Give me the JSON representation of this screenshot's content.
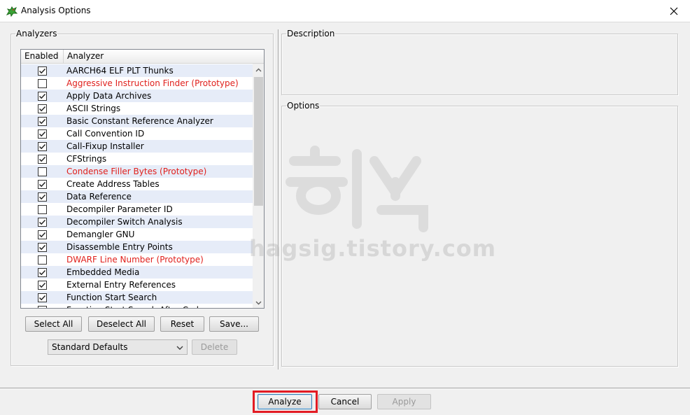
{
  "window": {
    "title": "Analysis Options",
    "icon": "ghidra-dragon-icon"
  },
  "analyzers": {
    "legend": "Analyzers",
    "columns": [
      "Enabled",
      "Analyzer"
    ],
    "items": [
      {
        "label": "AARCH64 ELF PLT Thunks",
        "enabled": true,
        "prototype": false
      },
      {
        "label": "Aggressive Instruction Finder (Prototype)",
        "enabled": false,
        "prototype": true
      },
      {
        "label": "Apply Data Archives",
        "enabled": true,
        "prototype": false
      },
      {
        "label": "ASCII Strings",
        "enabled": true,
        "prototype": false
      },
      {
        "label": "Basic Constant Reference Analyzer",
        "enabled": true,
        "prototype": false
      },
      {
        "label": "Call Convention ID",
        "enabled": true,
        "prototype": false
      },
      {
        "label": "Call-Fixup Installer",
        "enabled": true,
        "prototype": false
      },
      {
        "label": "CFStrings",
        "enabled": true,
        "prototype": false
      },
      {
        "label": "Condense Filler Bytes (Prototype)",
        "enabled": false,
        "prototype": true
      },
      {
        "label": "Create Address Tables",
        "enabled": true,
        "prototype": false
      },
      {
        "label": "Data Reference",
        "enabled": true,
        "prototype": false
      },
      {
        "label": "Decompiler Parameter ID",
        "enabled": false,
        "prototype": false
      },
      {
        "label": "Decompiler Switch Analysis",
        "enabled": true,
        "prototype": false
      },
      {
        "label": "Demangler GNU",
        "enabled": true,
        "prototype": false
      },
      {
        "label": "Disassemble Entry Points",
        "enabled": true,
        "prototype": false
      },
      {
        "label": "DWARF Line Number (Prototype)",
        "enabled": false,
        "prototype": true
      },
      {
        "label": "Embedded Media",
        "enabled": true,
        "prototype": false
      },
      {
        "label": "External Entry References",
        "enabled": true,
        "prototype": false
      },
      {
        "label": "Function Start Search",
        "enabled": true,
        "prototype": false
      },
      {
        "label": "Function Start Search After Code",
        "enabled": true,
        "prototype": false
      }
    ],
    "buttons": {
      "select_all": "Select All",
      "deselect_all": "Deselect All",
      "reset": "Reset",
      "save": "Save..."
    },
    "profile": {
      "selected": "Standard Defaults",
      "delete_label": "Delete"
    }
  },
  "description": {
    "legend": "Description"
  },
  "options": {
    "legend": "Options"
  },
  "footer": {
    "analyze": "Analyze",
    "cancel": "Cancel",
    "apply": "Apply"
  },
  "watermark": {
    "text": "학식",
    "url": "hagsig.tistory.com"
  },
  "colors": {
    "prototype_text": "#e0201c",
    "highlight": "#e31b23",
    "row_alt": "#e6ecf8"
  }
}
